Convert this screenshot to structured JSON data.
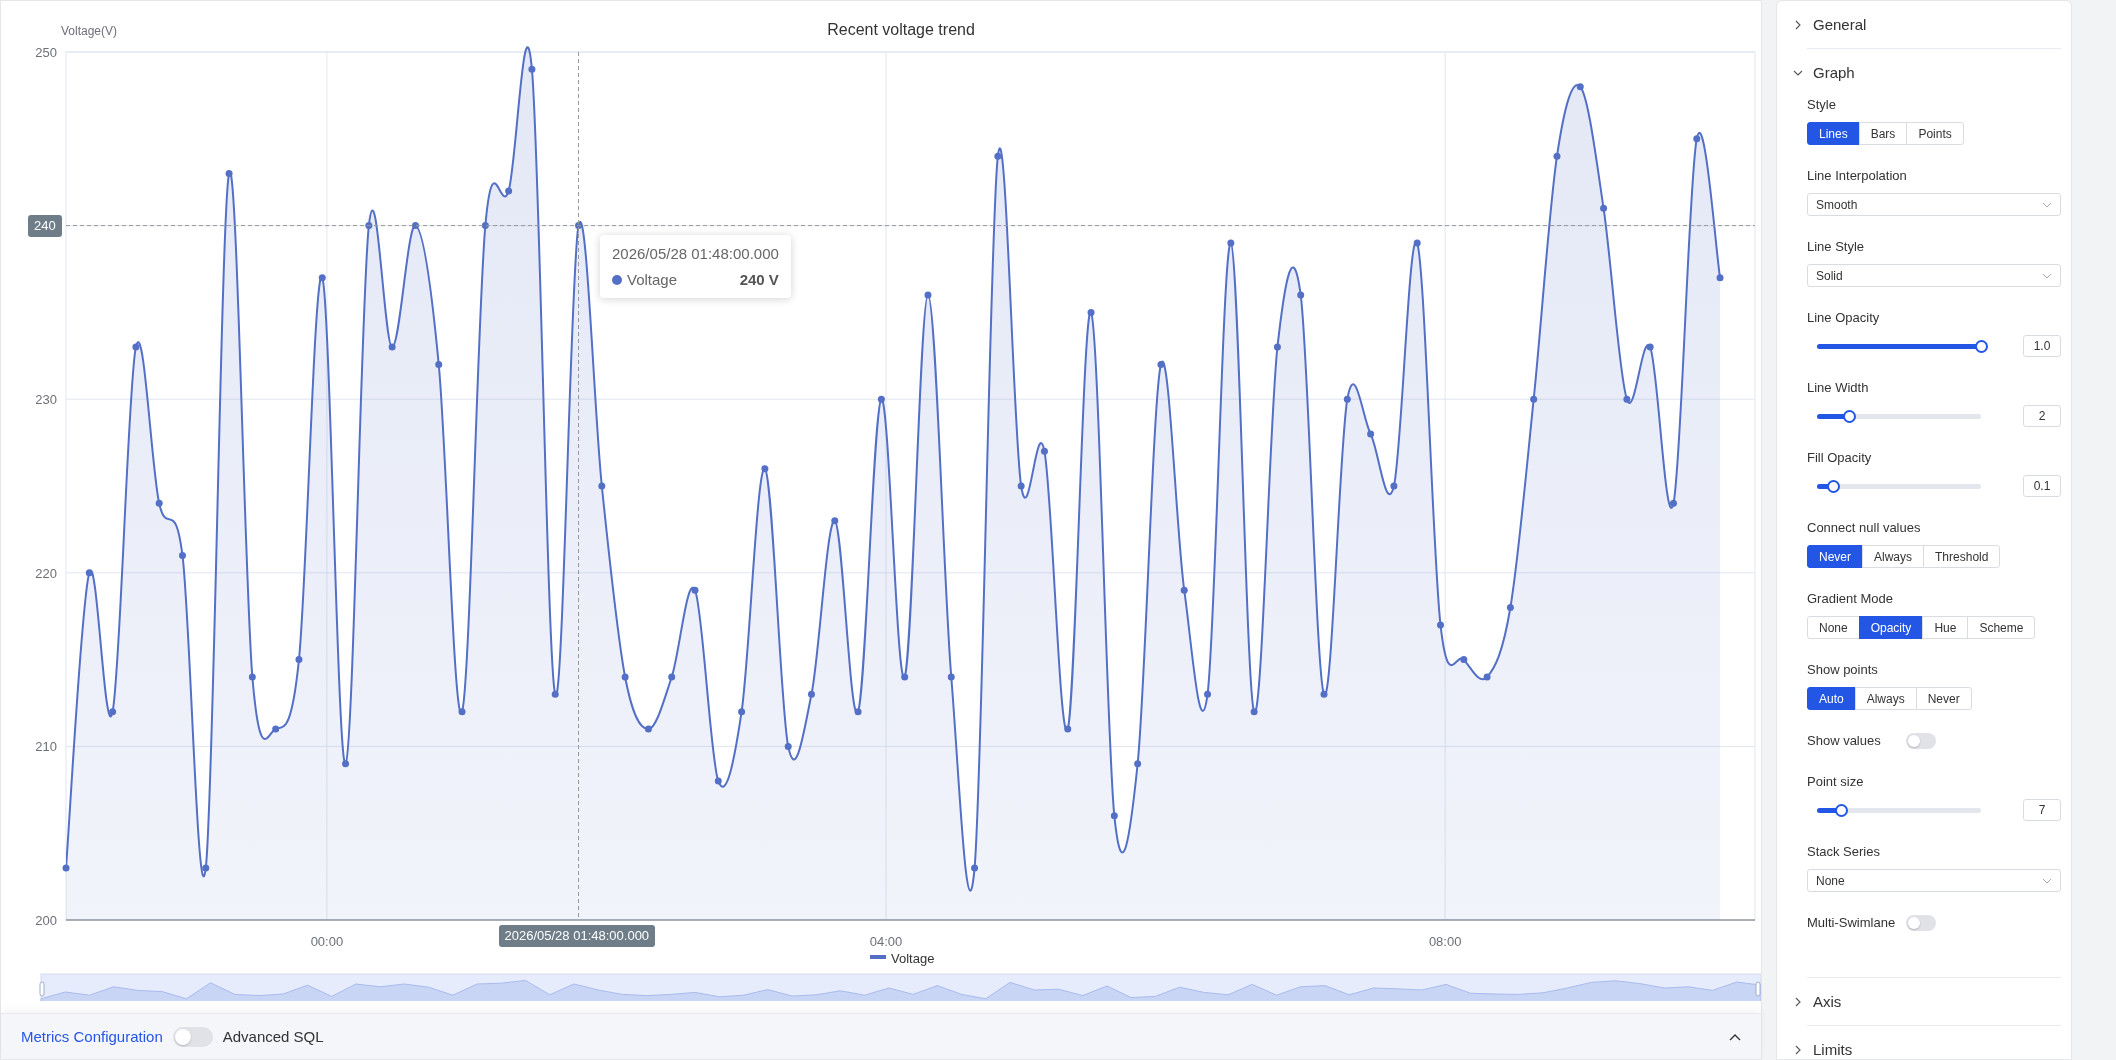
{
  "chart": {
    "title": "Recent voltage trend",
    "axis_pointer": {
      "time_label": "2026/05/28 01:48:00.000"
    },
    "tooltip": {
      "title": "2026/05/28 01:48:00.000",
      "series": "Voltage",
      "value": "240 V",
      "color": "#5470c6"
    },
    "chart_data": {
      "type": "area",
      "ylabel": "Voltage(V)",
      "x": [
        -112,
        -102,
        -92,
        -82,
        -72,
        -62,
        -52,
        -42,
        -32,
        -22,
        -12,
        -2,
        8,
        18,
        28,
        38,
        48,
        58,
        68,
        78,
        88,
        98,
        108,
        118,
        128,
        138,
        148,
        158,
        168,
        178,
        188,
        198,
        208,
        218,
        228,
        238,
        248,
        258,
        268,
        278,
        288,
        298,
        308,
        318,
        328,
        338,
        348,
        358,
        368,
        378,
        388,
        398,
        408,
        418,
        428,
        438,
        448,
        458,
        468,
        478,
        488,
        498,
        508,
        518,
        528,
        538,
        548,
        558,
        568,
        578,
        588,
        598
      ],
      "series": [
        {
          "name": "Voltage",
          "color": "#5470c6",
          "values": [
            203,
            220,
            212,
            233,
            224,
            221,
            203,
            243,
            214,
            211,
            215,
            237,
            209,
            240,
            233,
            240,
            232,
            212,
            240,
            242,
            249,
            213,
            240,
            225,
            214,
            211,
            214,
            219,
            208,
            212,
            226,
            210,
            213,
            223,
            212,
            230,
            214,
            236,
            214,
            203,
            244,
            225,
            227,
            211,
            235,
            206,
            209,
            232,
            219,
            213,
            239,
            212,
            233,
            236,
            213,
            230,
            228,
            225,
            239,
            217,
            215,
            214,
            218,
            230,
            244,
            248,
            241,
            230,
            233,
            224,
            245,
            237
          ]
        }
      ],
      "xlim": [
        -112,
        613
      ],
      "ylim": [
        200,
        250
      ],
      "xticks": [
        {
          "value": 0,
          "label": "00:00"
        },
        {
          "value": 240,
          "label": "04:00"
        },
        {
          "value": 480,
          "label": "08:00"
        }
      ],
      "yticks": [
        200,
        210,
        220,
        230,
        240,
        250
      ],
      "grid": true,
      "ref_lines": [
        {
          "axis": "y",
          "value": 240,
          "label": "240"
        },
        {
          "axis": "x",
          "value": 108
        }
      ]
    }
  },
  "bottom_bar": {
    "link": "Metrics Configuration",
    "toggle": {
      "label": "Advanced SQL",
      "on": false
    }
  },
  "settings": {
    "sections": [
      {
        "title": "General",
        "expanded": false
      },
      {
        "title": "Graph",
        "expanded": true,
        "fields": [
          {
            "kind": "segmented",
            "label": "Style",
            "options": [
              {
                "label": "Lines",
                "selected": true
              },
              {
                "label": "Bars",
                "selected": false
              },
              {
                "label": "Points",
                "selected": false
              }
            ]
          },
          {
            "kind": "select",
            "label": "Line Interpolation",
            "value": "Smooth"
          },
          {
            "kind": "select",
            "label": "Line Style",
            "value": "Solid"
          },
          {
            "kind": "slider",
            "label": "Line Opacity",
            "level": 1.0,
            "value": "1.0"
          },
          {
            "kind": "slider",
            "label": "Line Width",
            "level": 0.2,
            "value": "2"
          },
          {
            "kind": "slider",
            "label": "Fill Opacity",
            "level": 0.1,
            "value": "0.1"
          },
          {
            "kind": "segmented",
            "label": "Connect null values",
            "options": [
              {
                "label": "Never",
                "selected": true
              },
              {
                "label": "Always",
                "selected": false
              },
              {
                "label": "Threshold",
                "selected": false
              }
            ]
          },
          {
            "kind": "segmented",
            "label": "Gradient Mode",
            "options": [
              {
                "label": "None",
                "selected": false
              },
              {
                "label": "Opacity",
                "selected": true
              },
              {
                "label": "Hue",
                "selected": false
              },
              {
                "label": "Scheme",
                "selected": false
              }
            ]
          },
          {
            "kind": "segmented",
            "label": "Show points",
            "options": [
              {
                "label": "Auto",
                "selected": true
              },
              {
                "label": "Always",
                "selected": false
              },
              {
                "label": "Never",
                "selected": false
              }
            ]
          },
          {
            "kind": "toggle",
            "label": "Show values",
            "on": false
          },
          {
            "kind": "slider",
            "label": "Point size",
            "level": 0.15,
            "value": "7"
          },
          {
            "kind": "select",
            "label": "Stack Series",
            "value": "None"
          },
          {
            "kind": "toggle",
            "label": "Multi-Swimlane",
            "on": false
          }
        ]
      },
      {
        "title": "Axis",
        "expanded": false
      },
      {
        "title": "Limits",
        "expanded": false
      }
    ]
  }
}
